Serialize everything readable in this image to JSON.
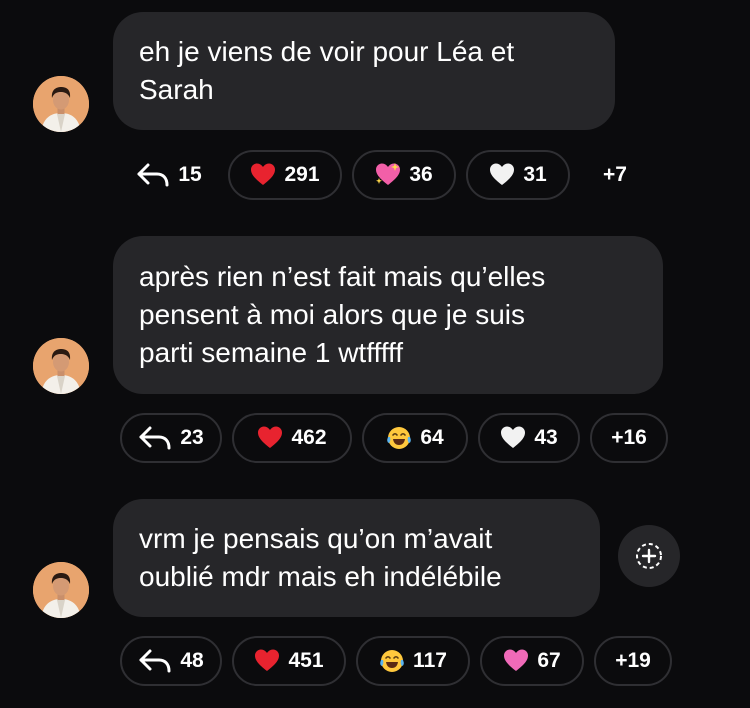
{
  "messages": [
    {
      "text_lines": [
        "eh je viens de voir pour Léa et",
        "Sarah"
      ],
      "reply_count": "15",
      "reactions": [
        {
          "emoji": "red-heart",
          "count": "291"
        },
        {
          "emoji": "sparkling-heart",
          "count": "36"
        },
        {
          "emoji": "white-heart",
          "count": "31"
        }
      ],
      "more": "+7"
    },
    {
      "text_lines": [
        "après rien n’est fait mais qu’elles",
        "pensent à moi alors que je suis",
        "parti semaine 1 wtfffff"
      ],
      "reply_count": "23",
      "reactions": [
        {
          "emoji": "red-heart",
          "count": "462"
        },
        {
          "emoji": "tears-of-joy",
          "count": "64"
        },
        {
          "emoji": "white-heart",
          "count": "43"
        }
      ],
      "more": "+16"
    },
    {
      "text_lines": [
        "vrm je pensais qu’on m’avait",
        "oublié mdr mais eh indélébile"
      ],
      "reply_count": "48",
      "reactions": [
        {
          "emoji": "red-heart",
          "count": "451"
        },
        {
          "emoji": "tears-of-joy",
          "count": "117"
        },
        {
          "emoji": "pink-heart",
          "count": "67"
        }
      ],
      "more": "+19"
    }
  ],
  "colors": {
    "background": "#0b0b0d",
    "bubble": "#262629",
    "pill_border": "#2f2f33"
  },
  "icons": {
    "reply": "reply-arrow-icon",
    "add_reaction": "add-reaction-icon"
  }
}
